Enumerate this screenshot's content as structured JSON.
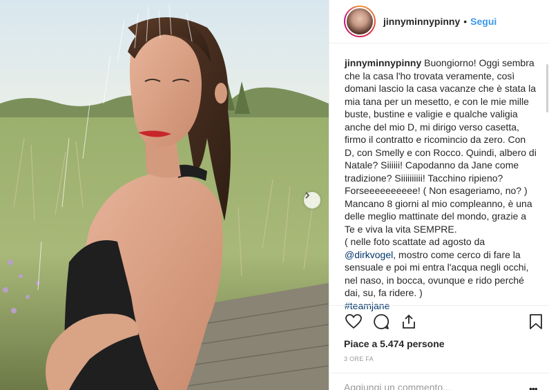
{
  "header": {
    "username": "jinnyminnypinny",
    "separator": "•",
    "follow_label": "Segui"
  },
  "caption": {
    "username": "jinnyminnypinny",
    "text_1": "Buongiorno! Oggi sembra che la casa l'ho trovata veramente, così domani lascio la casa vacanze che è stata la mia tana per un mesetto, e con le mie mille buste, bustine e valigie e qualche valigia anche del mio D, mi dirigo verso casetta, firmo il contratto e ricomincio da zero. Con D, con Smelly e con Rocco. Quindi, albero di Natale? Siiiiii! Capodanno da Jane come tradizione? Siiiiiiiiii! Tacchino ripieno? Forseeeeeeeeee! ( Non esageriamo, no? ) Mancano 8 giorni al mio compleanno, è una delle meglio mattinate del mondo, grazie a Te e viva la vita SEMPRE.",
    "text_2": "( nelle foto scattate ad agosto da",
    "mention": "@dirkvogel",
    "text_3": ", mostro come cerco di fare la sensuale e poi mi entra l'acqua negli occhi, nel naso, in bocca, ovunque e rido perché dai, su, fa ridere. )",
    "hashtag": "#teamjane"
  },
  "icons": {
    "like": "heart-icon",
    "comment": "comment-icon",
    "share": "share-icon",
    "save": "bookmark-icon",
    "next": "chevron-right-icon",
    "more": "more-icon"
  },
  "likes_text": "Piace a 5.474 persone",
  "timestamp": "3 ORE FA",
  "comment": {
    "placeholder": "Aggiungi un commento...",
    "more": "•••"
  }
}
